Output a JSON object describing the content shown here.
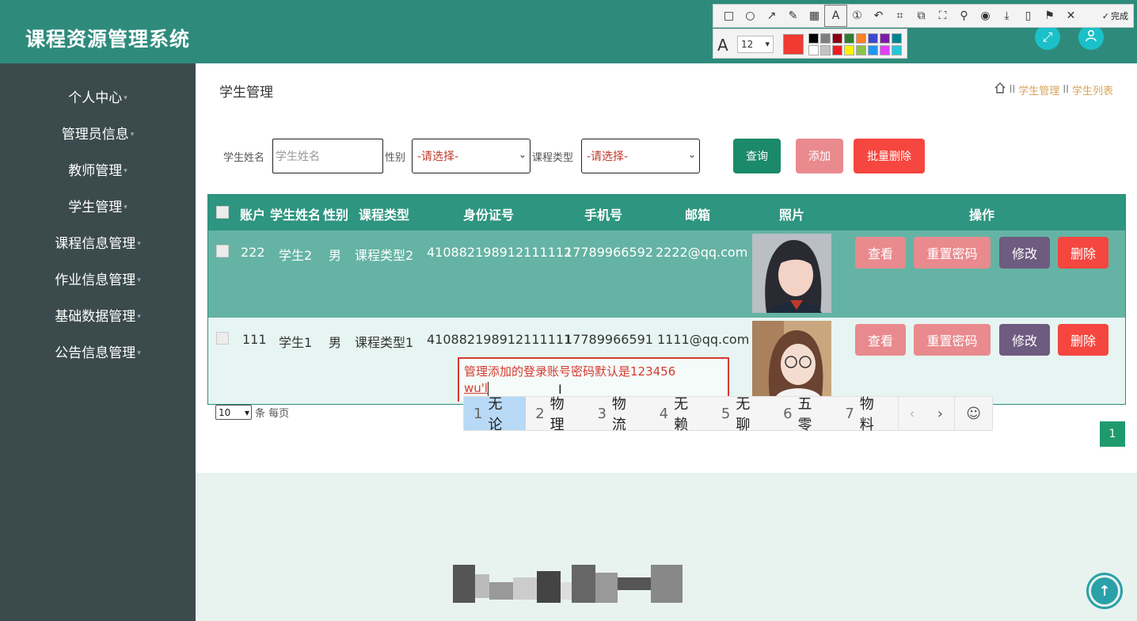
{
  "header": {
    "title": "课程资源管理系统"
  },
  "sidebar": {
    "items": [
      {
        "label": "个人中心"
      },
      {
        "label": "管理员信息"
      },
      {
        "label": "教师管理"
      },
      {
        "label": "学生管理"
      },
      {
        "label": "课程信息管理"
      },
      {
        "label": "作业信息管理"
      },
      {
        "label": "基础数据管理"
      },
      {
        "label": "公告信息管理"
      }
    ]
  },
  "main": {
    "page_title": "学生管理",
    "breadcrumb": [
      "学生管理",
      "学生列表"
    ],
    "search": {
      "name_label": "学生姓名",
      "name_placeholder": "学生姓名",
      "gender_label": "性别",
      "gender_value": "-请选择-",
      "course_type_label": "课程类型",
      "course_type_value": "-请选择-",
      "query_button": "查询",
      "add_button": "添加",
      "batch_delete_button": "批量删除"
    },
    "table": {
      "headers": [
        "账户",
        "学生姓名",
        "性别",
        "课程类型",
        "身份证号",
        "手机号",
        "邮箱",
        "照片",
        "操作"
      ],
      "rows": [
        {
          "account": "222",
          "name": "学生2",
          "gender": "男",
          "course_type": "课程类型2",
          "id_number": "410882198912111112",
          "phone": "17789966592",
          "email": "2222@qq.com"
        },
        {
          "account": "111",
          "name": "学生1",
          "gender": "男",
          "course_type": "课程类型1",
          "id_number": "410882198912111111",
          "phone": "17789966591",
          "email": "1111@qq.com"
        }
      ],
      "actions": {
        "view": "查看",
        "reset_password": "重置密码",
        "edit": "修改",
        "delete": "删除"
      }
    },
    "pager": {
      "page_size": "10",
      "suffix": "条 每页",
      "current_page": "1"
    }
  },
  "annotation": {
    "text_line1": "管理添加的登录账号密码默认是123456",
    "text_line2": "wu'l",
    "font_size": "12",
    "finish_label": "完成",
    "current_color": "#f03a32"
  },
  "ime": {
    "candidates": [
      {
        "n": "1",
        "w": "无论"
      },
      {
        "n": "2",
        "w": "物理"
      },
      {
        "n": "3",
        "w": "物流"
      },
      {
        "n": "4",
        "w": "无赖"
      },
      {
        "n": "5",
        "w": "无聊"
      },
      {
        "n": "6",
        "w": "五零"
      },
      {
        "n": "7",
        "w": "物料"
      }
    ]
  },
  "colors": {
    "header": "#2e8b7c",
    "sidebar": "#3b4a4d",
    "accent": "#2e9580"
  }
}
